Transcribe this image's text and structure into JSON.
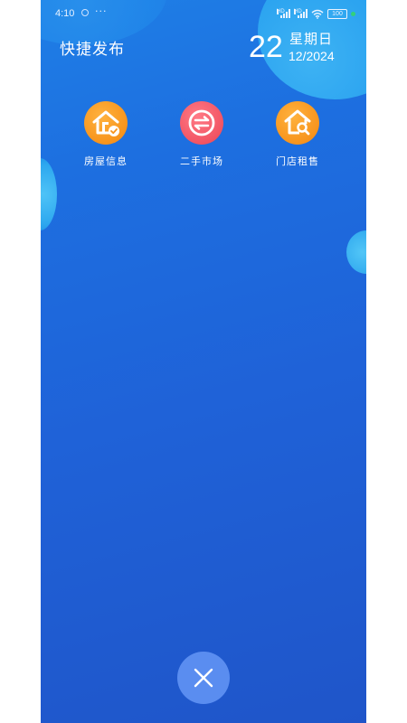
{
  "status_bar": {
    "time": "4:10",
    "more": "···",
    "signal_tag_1": "HD",
    "signal_tag_2": "HD",
    "battery": "100"
  },
  "header": {
    "title": "快捷发布"
  },
  "date": {
    "day": "22",
    "weekday": "星期日",
    "month_year": "12/2024"
  },
  "shortcuts": [
    {
      "label": "房屋信息",
      "icon": "house-check-icon",
      "color": "#f7941d"
    },
    {
      "label": "二手市场",
      "icon": "exchange-icon",
      "color": "#f25463"
    },
    {
      "label": "门店租售",
      "icon": "house-search-icon",
      "color": "#f7941d"
    }
  ],
  "close_button": {
    "icon": "close-icon",
    "color": "#5a8df0"
  },
  "colors": {
    "background_top": "#1f7fe6",
    "background_bottom": "#1f55c9",
    "accent_orange": "#f7941d",
    "accent_red": "#f25463"
  }
}
